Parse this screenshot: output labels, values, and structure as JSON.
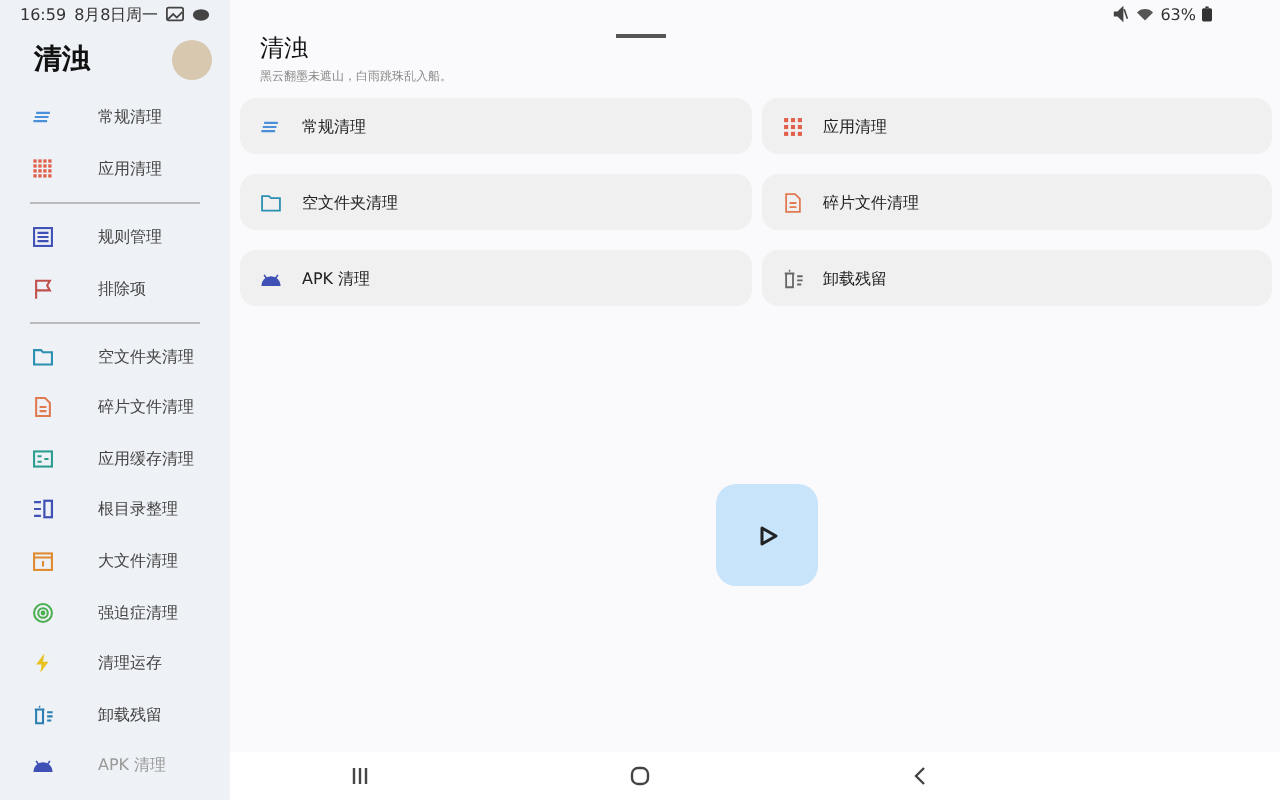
{
  "status_bar": {
    "time": "16:59",
    "date": "8月8日周一",
    "battery": "63%"
  },
  "sidebar": {
    "title": "清浊",
    "groups": [
      [
        {
          "label": "常规清理",
          "kind": "lines"
        },
        {
          "label": "应用清理",
          "kind": "grid"
        }
      ],
      [
        {
          "label": "规则管理",
          "kind": "list"
        },
        {
          "label": "排除项",
          "kind": "flag"
        }
      ],
      [
        {
          "label": "空文件夹清理",
          "kind": "folder"
        },
        {
          "label": "碎片文件清理",
          "kind": "file"
        },
        {
          "label": "应用缓存清理",
          "kind": "cache"
        },
        {
          "label": "根目录整理",
          "kind": "dir"
        },
        {
          "label": "大文件清理",
          "kind": "box"
        },
        {
          "label": "强迫症清理",
          "kind": "target"
        },
        {
          "label": "清理运存",
          "kind": "bolt"
        },
        {
          "label": "卸载残留",
          "kind": "uninstall"
        },
        {
          "label": "APK 清理",
          "kind": "android"
        }
      ]
    ]
  },
  "main": {
    "title": "清浊",
    "subtitle": "黑云翻墨未遮山，白雨跳珠乱入船。",
    "cards": [
      {
        "label": "常规清理",
        "kind": "lines"
      },
      {
        "label": "应用清理",
        "kind": "grid"
      },
      {
        "label": "空文件夹清理",
        "kind": "folder"
      },
      {
        "label": "碎片文件清理",
        "kind": "file"
      },
      {
        "label": "APK 清理",
        "kind": "android"
      },
      {
        "label": "卸载残留",
        "kind": "uninstall"
      }
    ]
  }
}
